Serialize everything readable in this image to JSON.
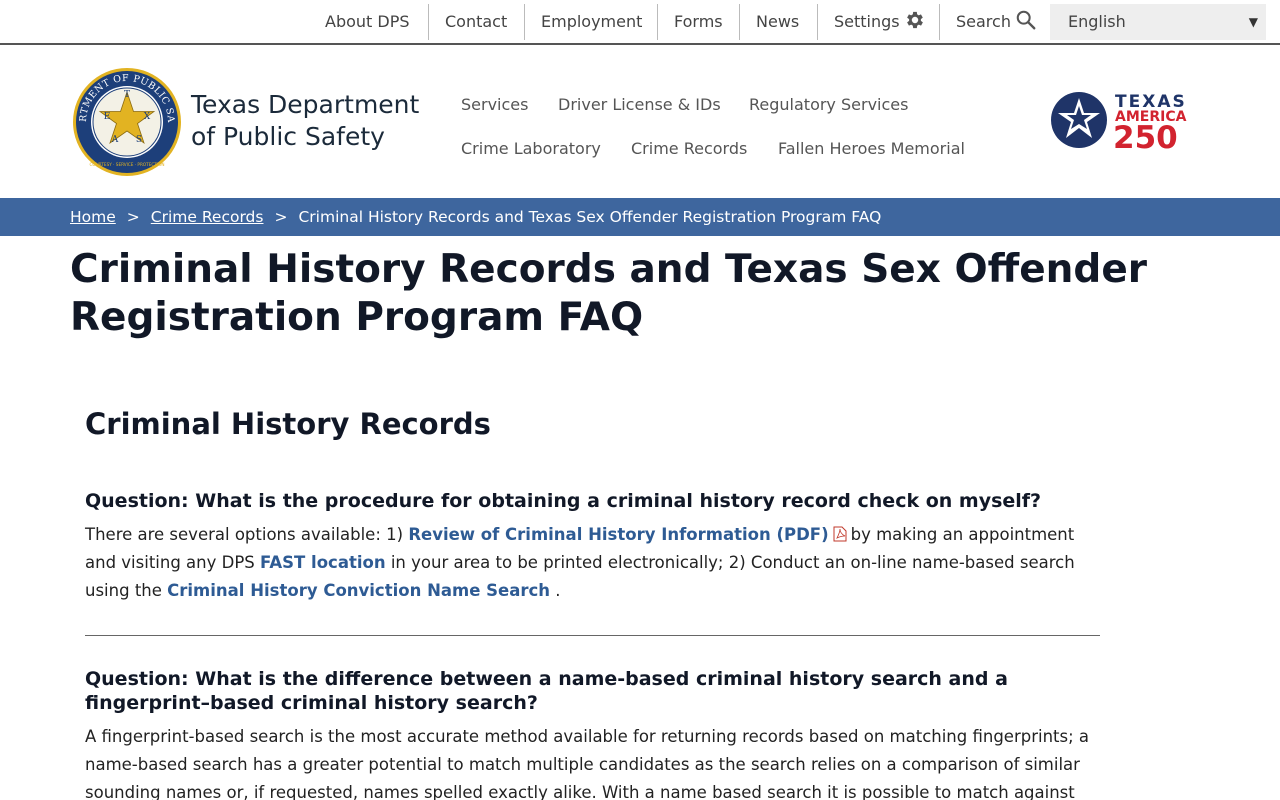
{
  "utility_nav": {
    "items": [
      "About DPS",
      "Contact",
      "Employment",
      "Forms",
      "News"
    ],
    "settings_label": "Settings",
    "search_label": "Search",
    "language": "English"
  },
  "header": {
    "agency_line1": "Texas Department",
    "agency_line2": "of Public Safety",
    "seal_text": "DEPARTMENT OF PUBLIC SAFETY",
    "seal_letters": [
      "T",
      "E",
      "X",
      "A",
      "S"
    ],
    "seal_motto": "COURTESY · SERVICE · PROTECTION",
    "nav": [
      "Services",
      "Driver License & IDs",
      "Regulatory Services",
      "Crime Laboratory",
      "Crime Records",
      "Fallen Heroes Memorial"
    ],
    "t250_line1": "TEXAS",
    "t250_line2": "AMERICA",
    "t250_line3": "250"
  },
  "breadcrumb": {
    "home": "Home",
    "section": "Crime Records",
    "sep": ">",
    "current": "Criminal History Records and Texas Sex Offender Registration Program FAQ"
  },
  "page": {
    "title": "Criminal History Records and Texas Sex Offender Registration Program FAQ",
    "section_heading": "Criminal History Records",
    "q1": {
      "question": "Question: What is the procedure for obtaining a criminal history record check on myself?",
      "a_text1": "There are several options available: 1)",
      "a_link1": "Review of Criminal History Information (PDF)",
      "a_text2": "by making an appointment and visiting any DPS",
      "a_link2": "FAST location",
      "a_text3": "in your area to be printed electronically; 2) Conduct an on-line name-based search using the",
      "a_link3": "Criminal History Conviction Name Search",
      "a_text4": "."
    },
    "q2": {
      "question": "Question: What is the difference between a name-based criminal history search and a fingerprint–based criminal history search?",
      "answer": "A fingerprint-based search is the most accurate method available for returning records based on matching fingerprints; a name-based search has a greater potential to match multiple candidates as the search relies on a comparison of similar sounding names or, if requested, names spelled exactly alike. With a name based search it is possible to match against records that do not relate to the"
    }
  },
  "colors": {
    "breadcrumb_bg": "#3e669e",
    "link": "#2e5b94",
    "seal_blue": "#1d3f7a",
    "seal_gold": "#e2b322",
    "t250_red": "#d2232f",
    "t250_navy": "#1f3468"
  }
}
